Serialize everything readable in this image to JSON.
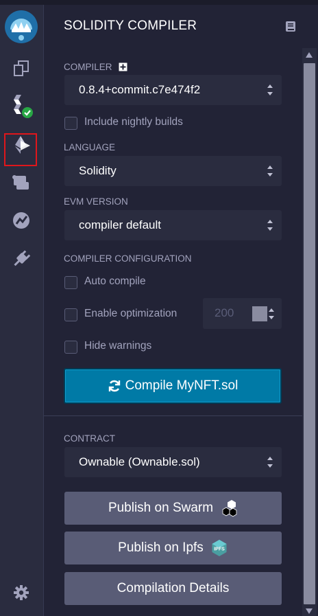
{
  "sidebar": {
    "icons": [
      "remix-logo-icon",
      "file-explorer-icon",
      "solidity-compiler-icon",
      "deploy-run-icon",
      "scroll-icon",
      "analytics-icon",
      "plugin-manager-icon",
      "settings-icon"
    ],
    "active_item": "deploy-run-icon",
    "success_badge_color": "#28a745",
    "highlight_color": "#e0161b"
  },
  "panel": {
    "title": "SOLIDITY COMPILER",
    "compiler": {
      "label": "COMPILER",
      "selected": "0.8.4+commit.c7e474f2",
      "nightly_label": "Include nightly builds"
    },
    "language": {
      "label": "LANGUAGE",
      "selected": "Solidity"
    },
    "evm": {
      "label": "EVM VERSION",
      "selected": "compiler default"
    },
    "config": {
      "label": "COMPILER CONFIGURATION",
      "auto_compile": "Auto compile",
      "enable_optimization": "Enable optimization",
      "runs_value": "200",
      "hide_warnings": "Hide warnings"
    },
    "compile_button": "Compile MyNFT.sol",
    "contract": {
      "label": "CONTRACT",
      "selected": "Ownable (Ownable.sol)"
    },
    "publish_swarm": "Publish on Swarm",
    "publish_ipfs": "Publish on Ipfs",
    "ipfs_badge": "IPFS",
    "compilation_details": "Compilation Details"
  },
  "colors": {
    "accent": "#007aa6",
    "panel_bg": "#222336",
    "input_bg": "#2a2c3f",
    "button_bg": "#595c76"
  }
}
